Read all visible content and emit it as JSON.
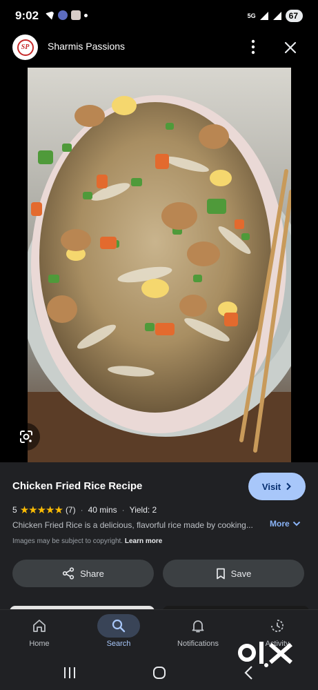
{
  "status_bar": {
    "time": "9:02",
    "network": "5G",
    "battery": "67"
  },
  "header": {
    "site_name": "Sharmis Passions",
    "logo_text": "SP"
  },
  "info": {
    "title": "Chicken Fried Rice Recipe",
    "visit_label": "Visit",
    "rating": "5",
    "stars": "★★★★★",
    "review_count": "(7)",
    "time": "40 mins",
    "yield": "Yield: 2",
    "description": "Chicken Fried Rice is a delicious, flavorful rice made by cooking...",
    "more_label": "More",
    "copyright_text": "Images may be subject to copyright.",
    "learn_more": "Learn more",
    "share_label": "Share",
    "save_label": "Save"
  },
  "bottom_nav": {
    "items": [
      {
        "label": "Home",
        "icon": "home-icon"
      },
      {
        "label": "Search",
        "icon": "search-icon",
        "active": true
      },
      {
        "label": "Notifications",
        "icon": "bell-icon"
      },
      {
        "label": "Activity",
        "icon": "activity-icon"
      }
    ]
  },
  "watermark": "OLX",
  "colors": {
    "accent": "#a8c7fa",
    "star": "#fbbc04",
    "link": "#8ab4f8",
    "background": "#202124"
  }
}
